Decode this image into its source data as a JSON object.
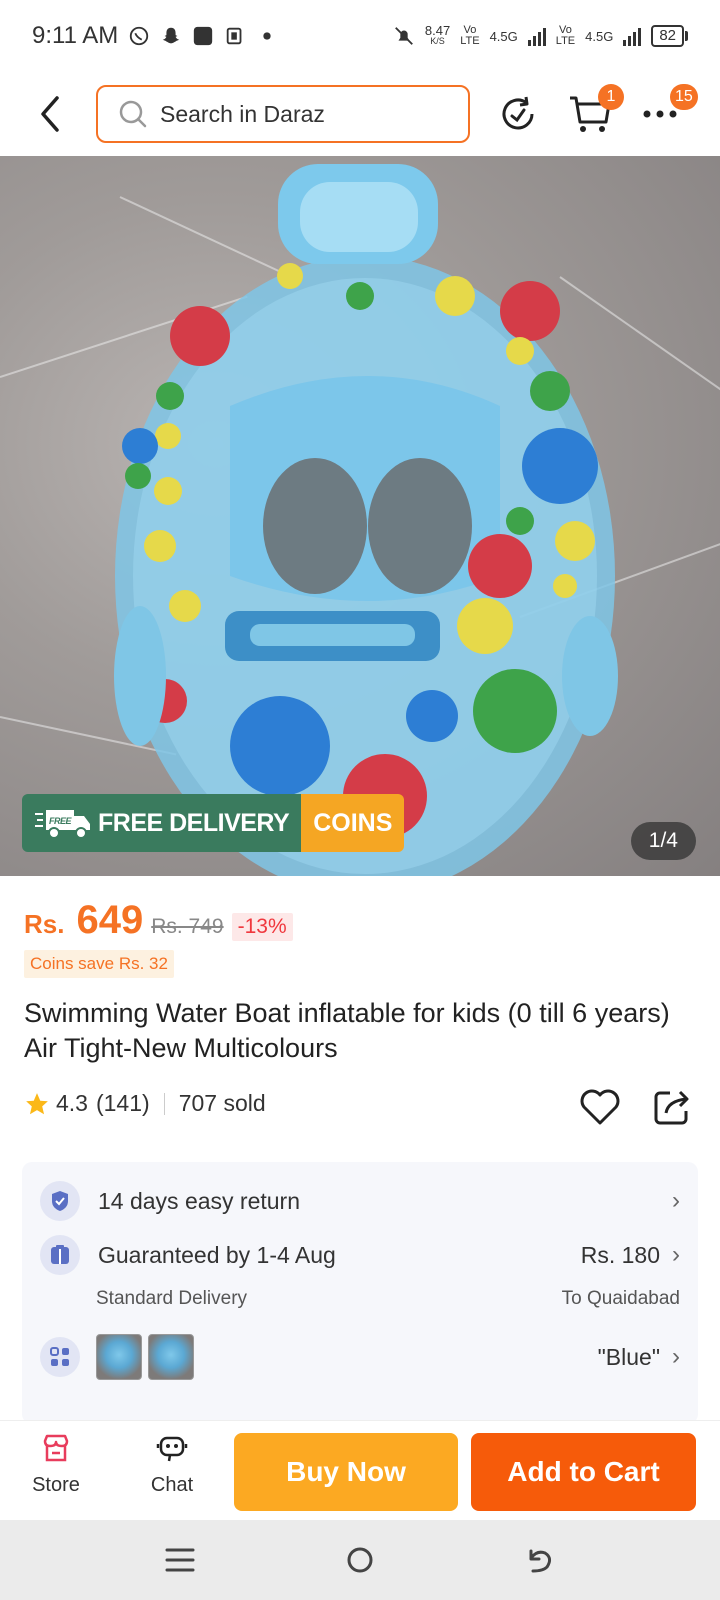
{
  "status_bar": {
    "time": "9:11 AM",
    "net_speed_value": "8.47",
    "net_speed_unit": "K/S",
    "sim1_label": "Vo",
    "sim1_sub": "LTE",
    "sim1_net": "4.5G",
    "sim2_label": "Vo",
    "sim2_sub": "LTE",
    "sim2_net": "4.5G",
    "battery": "82"
  },
  "header": {
    "search_placeholder": "Search in Daraz",
    "cart_badge": "1",
    "more_badge": "15"
  },
  "gallery": {
    "counter": "1/4",
    "promo_free_icon_text": "FREE",
    "promo_free_label": "FREE DELIVERY",
    "promo_coins_label": "COINS"
  },
  "product": {
    "currency": "Rs.",
    "price": "649",
    "old_price": "Rs. 749",
    "discount": "-13%",
    "coins_save": "Coins save Rs. 32",
    "title": "Swimming Water Boat inflatable for kids (0 till 6 years) Air Tight-New Multicolours",
    "rating": "4.3",
    "reviews": "(141)",
    "sold": "707 sold"
  },
  "info": {
    "return_text": "14 days easy return",
    "delivery_text": "Guaranteed by 1-4 Aug",
    "delivery_type": "Standard Delivery",
    "delivery_fee": "Rs. 180",
    "delivery_to": "To Quaidabad",
    "variant": "\"Blue\""
  },
  "actions": {
    "store_label": "Store",
    "chat_label": "Chat",
    "buy_now": "Buy Now",
    "add_to_cart": "Add to Cart"
  },
  "colors": {
    "accent": "#f57224",
    "buy_now": "#fca922",
    "add_to_cart": "#f65b0a",
    "free_delivery": "#3a7b5e"
  }
}
